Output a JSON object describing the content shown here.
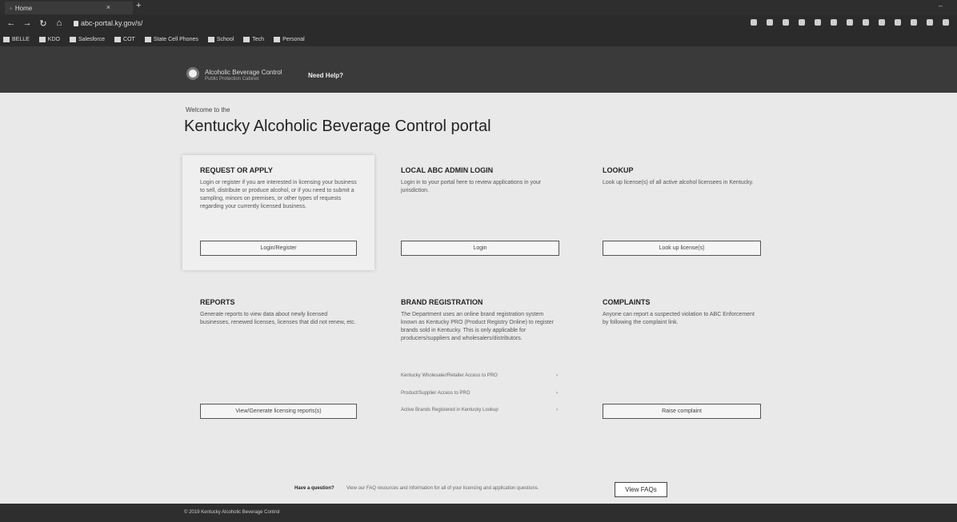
{
  "browser": {
    "tab_title": "Home",
    "url": "abc-portal.ky.gov/s/",
    "bookmarks": [
      "BELLE",
      "KDO",
      "Salesforce",
      "COT",
      "State Cell Phones",
      "School",
      "Tech",
      "Personal"
    ]
  },
  "header": {
    "org_name": "Alcoholic Beverage Control",
    "org_sub": "Public Protection Cabinet",
    "help_link": "Need Help?"
  },
  "main": {
    "welcome": "Welcome to the",
    "title": "Kentucky Alcoholic Beverage Control portal"
  },
  "cards": {
    "request": {
      "heading": "REQUEST OR APPLY",
      "body": "Login or register if you are interested in licensing your business to sell, distribute or produce alcohol, or if you need to submit a sampling, minors on premises, or other types of requests regarding your currently licensed business.",
      "button": "Login/Register"
    },
    "local_admin": {
      "heading": "LOCAL ABC ADMIN LOGIN",
      "body": "Login in to your portal here to review applications in your jurisdiction.",
      "button": "Login"
    },
    "lookup": {
      "heading": "LOOKUP",
      "body": "Look up license(s) of all active alcohol licensees in Kentucky.",
      "button": "Look up license(s)"
    },
    "reports": {
      "heading": "REPORTS",
      "body": "Generate reports to view data about newly licensed businesses, renewed licenses, licenses that did not renew, etc.",
      "button": "View/Generate licensing reports(s)"
    },
    "brand": {
      "heading": "BRAND REGISTRATION",
      "body": "The Department uses an online brand registration system known as Kentucky PRO (Product Registry Online) to register brands sold in Kentucky. This is only applicable for producers/suppliers and wholesalers/distributors.",
      "links": [
        "Kentucky Wholesaler/Retailer Access to PRO",
        "Product/Supplier Access to PRO",
        "Active Brands Registered in Kentucky Lookup"
      ]
    },
    "complaints": {
      "heading": "COMPLAINTS",
      "body": "Anyone can report a suspected violation to ABC Enforcement by following the complaint link.",
      "button": "Raise complaint"
    }
  },
  "faq": {
    "lead": "Have a question?",
    "text": "View our FAQ resources and information for all of your licensing and application questions.",
    "button": "View FAQs"
  },
  "footer": {
    "copyright": "© 2019 Kentucky Alcoholic Beverage Control"
  }
}
